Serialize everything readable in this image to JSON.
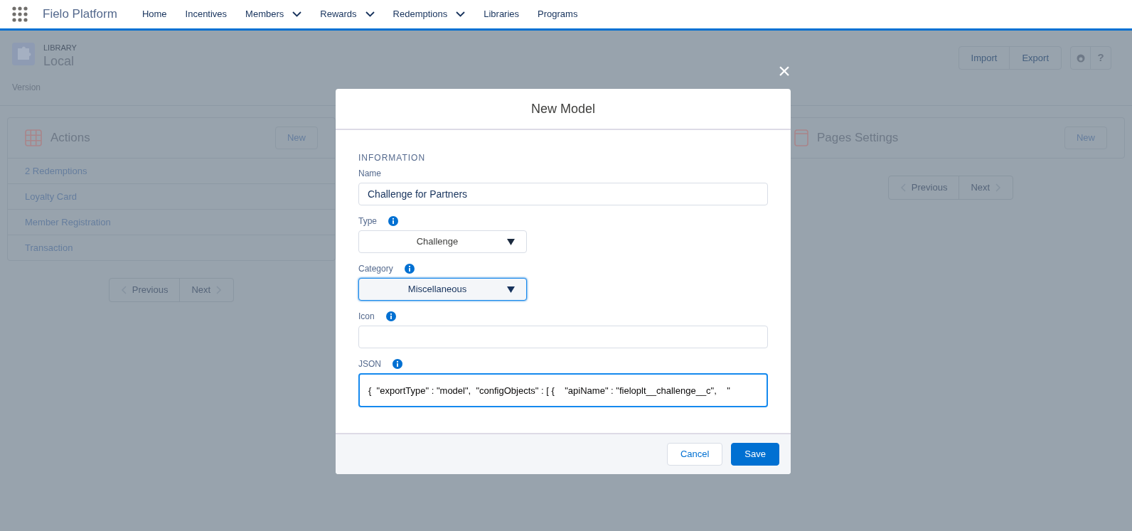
{
  "app": {
    "name": "Fielo Platform"
  },
  "nav": [
    {
      "label": "Home",
      "dropdown": false
    },
    {
      "label": "Incentives",
      "dropdown": false
    },
    {
      "label": "Members",
      "dropdown": true
    },
    {
      "label": "Rewards",
      "dropdown": true
    },
    {
      "label": "Redemptions",
      "dropdown": true
    },
    {
      "label": "Libraries",
      "dropdown": false
    },
    {
      "label": "Programs",
      "dropdown": false
    }
  ],
  "page": {
    "object_label": "LIBRARY",
    "title": "Local",
    "header_buttons": [
      "Import",
      "Export"
    ],
    "help": "?",
    "version_label": "Version"
  },
  "cards": [
    {
      "kind": "actions",
      "title": "Actions",
      "new_button": "New",
      "rows": [
        "2 Redemptions",
        "Loyalty Card",
        "Member Registration",
        "Transaction"
      ],
      "pagination": {
        "previous": "Previous",
        "next": "Next"
      }
    },
    {
      "kind": "pages",
      "title": "Pages Settings",
      "new_button": "New",
      "pagination": {
        "previous": "Previous",
        "next": "Next"
      }
    }
  ],
  "modal": {
    "close": "×",
    "title": "New Model",
    "section": "INFORMATION",
    "fields": [
      {
        "kind": "text",
        "label": "Name",
        "info": false,
        "focused": false,
        "value": "Challenge for Partners"
      },
      {
        "kind": "select",
        "label": "Type",
        "info": true,
        "focused": false,
        "value": "Challenge"
      },
      {
        "kind": "select",
        "label": "Category",
        "info": true,
        "focused": true,
        "value": "Miscellaneous"
      },
      {
        "kind": "text",
        "label": "Icon",
        "info": true,
        "focused": false
      },
      {
        "kind": "code",
        "label": "JSON",
        "info": true,
        "focused": true,
        "value": "{  \"exportType\" : \"model\",  \"configObjects\" : [ {    \"apiName\" : \"fieloplt__challenge__c\",    \""
      }
    ],
    "buttons": [
      {
        "kind": "neutral",
        "label": "Cancel"
      },
      {
        "kind": "brand",
        "label": "Save"
      }
    ]
  }
}
